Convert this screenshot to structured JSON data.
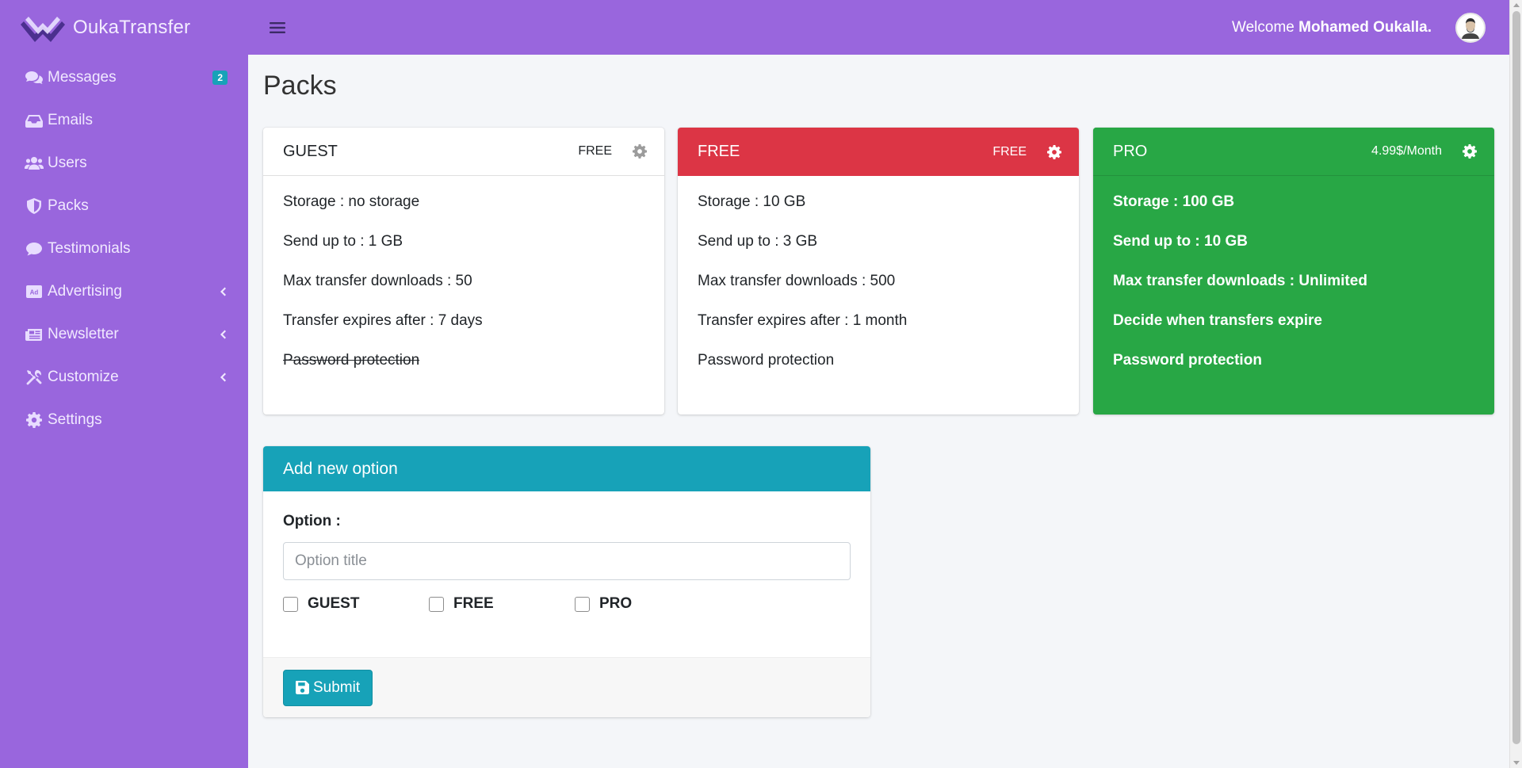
{
  "brand": {
    "name": "OukaTransfer"
  },
  "sidebar": {
    "items": [
      {
        "label": "Messages",
        "icon": "comments-icon",
        "badge": "2"
      },
      {
        "label": "Emails",
        "icon": "inbox-icon"
      },
      {
        "label": "Users",
        "icon": "users-icon"
      },
      {
        "label": "Packs",
        "icon": "shield-icon"
      },
      {
        "label": "Testimonials",
        "icon": "comment-icon"
      },
      {
        "label": "Advertising",
        "icon": "ad-icon",
        "expandable": true
      },
      {
        "label": "Newsletter",
        "icon": "newspaper-icon",
        "expandable": true
      },
      {
        "label": "Customize",
        "icon": "tools-icon",
        "expandable": true
      },
      {
        "label": "Settings",
        "icon": "gear-icon"
      }
    ]
  },
  "topbar": {
    "welcome_prefix": "Welcome",
    "user_name": "Mohamed Oukalla."
  },
  "page": {
    "title": "Packs"
  },
  "packs": [
    {
      "name": "GUEST",
      "price": "FREE",
      "features": [
        "Storage : no storage",
        "Send up to : 1 GB",
        "Max transfer downloads : 50",
        "Transfer expires after : 7 days",
        "Password protection"
      ],
      "disabled_feature": "Password protection"
    },
    {
      "name": "FREE",
      "price": "FREE",
      "header_color": "#dc3545",
      "features": [
        "Storage : 10 GB",
        "Send up to : 3 GB",
        "Max transfer downloads : 500",
        "Transfer expires after : 1 month",
        "Password protection"
      ]
    },
    {
      "name": "PRO",
      "price": "4.99$/Month",
      "header_color": "#28a745",
      "features": [
        "Storage : 100 GB",
        "Send up to : 10 GB",
        "Max transfer downloads : Unlimited",
        "Decide when transfers expire",
        "Password protection"
      ]
    }
  ],
  "form": {
    "title": "Add new option",
    "option_label": "Option :",
    "option_placeholder": "Option title",
    "option_value": "",
    "checkboxes": [
      {
        "label": "GUEST",
        "checked": false
      },
      {
        "label": "FREE",
        "checked": false
      },
      {
        "label": "PRO",
        "checked": false
      }
    ],
    "submit_label": "Submit"
  },
  "colors": {
    "sidebar": "#9966dd",
    "info": "#17a2b8",
    "danger": "#dc3545",
    "success": "#28a745",
    "background": "#f4f6f9"
  }
}
